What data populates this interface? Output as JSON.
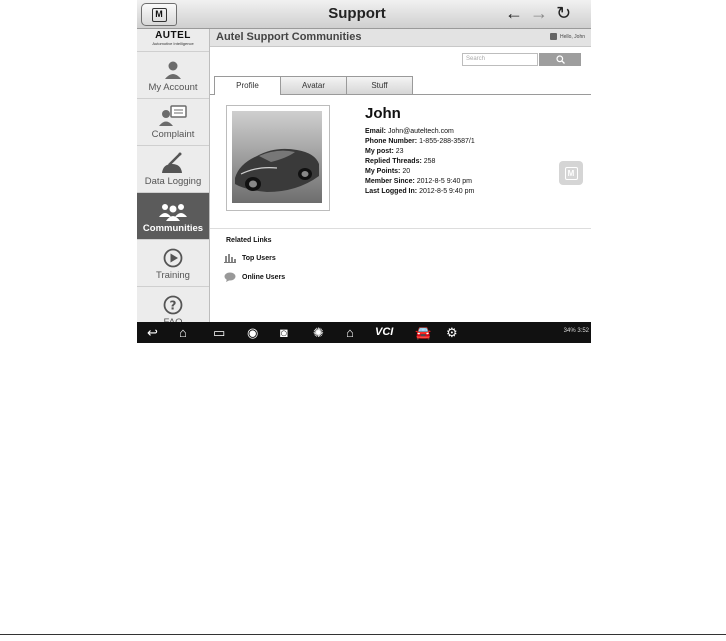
{
  "topbar": {
    "title": "Support",
    "home_label": "M"
  },
  "sidebar": {
    "brand": "AUTEL",
    "tagline": "Automotive Intelligence",
    "items": [
      {
        "label": "My Account",
        "icon": "user-icon"
      },
      {
        "label": "Complaint",
        "icon": "complaint-icon"
      },
      {
        "label": "Data Logging",
        "icon": "data-logging-icon"
      },
      {
        "label": "Communities",
        "icon": "communities-icon",
        "active": true
      },
      {
        "label": "Training",
        "icon": "play-icon"
      },
      {
        "label": "FAQ",
        "icon": "question-icon"
      }
    ]
  },
  "main": {
    "title": "Autel Support Communities",
    "hello": "Hello, John",
    "search_placeholder": "Search",
    "tabs": [
      {
        "label": "Profile",
        "active": true
      },
      {
        "label": "Avatar"
      },
      {
        "label": "Stuff"
      }
    ],
    "profile": {
      "name": "John",
      "email_label": "Email:",
      "email": "John@auteltech.com",
      "phone_label": "Phone Number:",
      "phone": "1-855-288-3587/1",
      "post_label": "My post:",
      "post": "23",
      "replied_label": "Replied Threads:",
      "replied": "258",
      "points_label": "My Points:",
      "points": "20",
      "member_label": "Member Since:",
      "member": "2012-8-5 9:40 pm",
      "last_label": "Last Logged In:",
      "last": "2012-8-5 9:40 pm"
    },
    "badge": "M",
    "related": {
      "title": "Related Links",
      "top_users": "Top Users",
      "online_users": "Online Users"
    }
  },
  "navbar": {
    "status": "34% 3:52",
    "vci": "VCI"
  }
}
